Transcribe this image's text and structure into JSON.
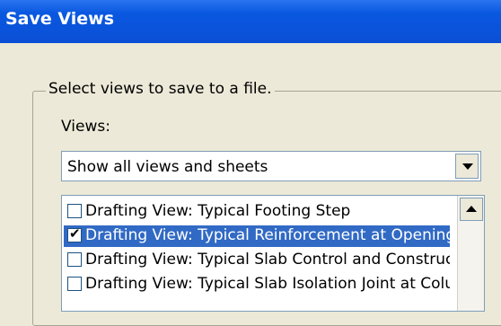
{
  "window": {
    "title": "Save Views"
  },
  "group": {
    "legend": "Select views to save to a file."
  },
  "views": {
    "label": "Views:",
    "filter_selected": "Show all views and sheets"
  },
  "list": {
    "items": [
      {
        "label": "Drafting View: Typical Footing Step",
        "checked": false,
        "selected": false
      },
      {
        "label": "Drafting View: Typical Reinforcement at Opening",
        "checked": true,
        "selected": true
      },
      {
        "label": "Drafting View: Typical Slab Control and Construction Joints",
        "checked": false,
        "selected": false
      },
      {
        "label": "Drafting View: Typical Slab Isolation Joint at Column",
        "checked": false,
        "selected": false
      }
    ]
  },
  "icons": {
    "dropdown": "chevron-down-icon",
    "scroll_up": "scroll-up-arrow-icon",
    "check": "check-icon"
  },
  "colors": {
    "titlebar": "#0a58e0",
    "selection": "#316ac5",
    "dialog_bg": "#ece9d8"
  }
}
